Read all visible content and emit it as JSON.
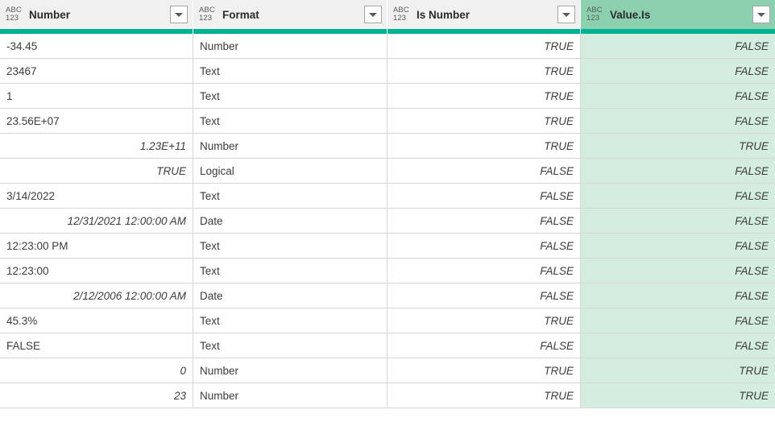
{
  "colors": {
    "header_bg": "#F0F0F0",
    "header_selected_bg": "#8DD0B0",
    "accent_bar": "#00B294",
    "cell_selected_bg": "#D4EDDF",
    "grid_line": "#D6D6D6",
    "text": "#3C3C3C"
  },
  "table": {
    "type_icon_top": "ABC",
    "type_icon_bottom": "123",
    "columns": [
      {
        "label": "Number",
        "type_icon": "abc-123-icon",
        "selected": false
      },
      {
        "label": "Format",
        "type_icon": "abc-123-icon",
        "selected": false
      },
      {
        "label": "Is Number",
        "type_icon": "abc-123-icon",
        "selected": false
      },
      {
        "label": "Value.Is",
        "type_icon": "abc-123-icon",
        "selected": true
      }
    ],
    "rows": [
      {
        "number": "-34.45",
        "number_align": "left",
        "number_italic": false,
        "format": "Number",
        "is_number": "TRUE",
        "value_is": "FALSE"
      },
      {
        "number": "23467",
        "number_align": "left",
        "number_italic": false,
        "format": "Text",
        "is_number": "TRUE",
        "value_is": "FALSE"
      },
      {
        "number": "1",
        "number_align": "left",
        "number_italic": false,
        "format": "Text",
        "is_number": "TRUE",
        "value_is": "FALSE"
      },
      {
        "number": "23.56E+07",
        "number_align": "left",
        "number_italic": false,
        "format": "Text",
        "is_number": "TRUE",
        "value_is": "FALSE"
      },
      {
        "number": "1.23E+11",
        "number_align": "right",
        "number_italic": true,
        "format": "Number",
        "is_number": "TRUE",
        "value_is": "TRUE"
      },
      {
        "number": "TRUE",
        "number_align": "right",
        "number_italic": true,
        "format": "Logical",
        "is_number": "FALSE",
        "value_is": "FALSE"
      },
      {
        "number": "3/14/2022",
        "number_align": "left",
        "number_italic": false,
        "format": "Text",
        "is_number": "FALSE",
        "value_is": "FALSE"
      },
      {
        "number": "12/31/2021 12:00:00 AM",
        "number_align": "right",
        "number_italic": true,
        "format": "Date",
        "is_number": "FALSE",
        "value_is": "FALSE"
      },
      {
        "number": "12:23:00 PM",
        "number_align": "left",
        "number_italic": false,
        "format": "Text",
        "is_number": "FALSE",
        "value_is": "FALSE"
      },
      {
        "number": "12:23:00",
        "number_align": "left",
        "number_italic": false,
        "format": "Text",
        "is_number": "FALSE",
        "value_is": "FALSE"
      },
      {
        "number": "2/12/2006 12:00:00 AM",
        "number_align": "right",
        "number_italic": true,
        "format": "Date",
        "is_number": "FALSE",
        "value_is": "FALSE"
      },
      {
        "number": "45.3%",
        "number_align": "left",
        "number_italic": false,
        "format": "Text",
        "is_number": "TRUE",
        "value_is": "FALSE"
      },
      {
        "number": "FALSE",
        "number_align": "left",
        "number_italic": false,
        "format": "Text",
        "is_number": "FALSE",
        "value_is": "FALSE"
      },
      {
        "number": "0",
        "number_align": "right",
        "number_italic": true,
        "format": "Number",
        "is_number": "TRUE",
        "value_is": "TRUE"
      },
      {
        "number": "23",
        "number_align": "right",
        "number_italic": true,
        "format": "Number",
        "is_number": "TRUE",
        "value_is": "TRUE"
      }
    ]
  }
}
